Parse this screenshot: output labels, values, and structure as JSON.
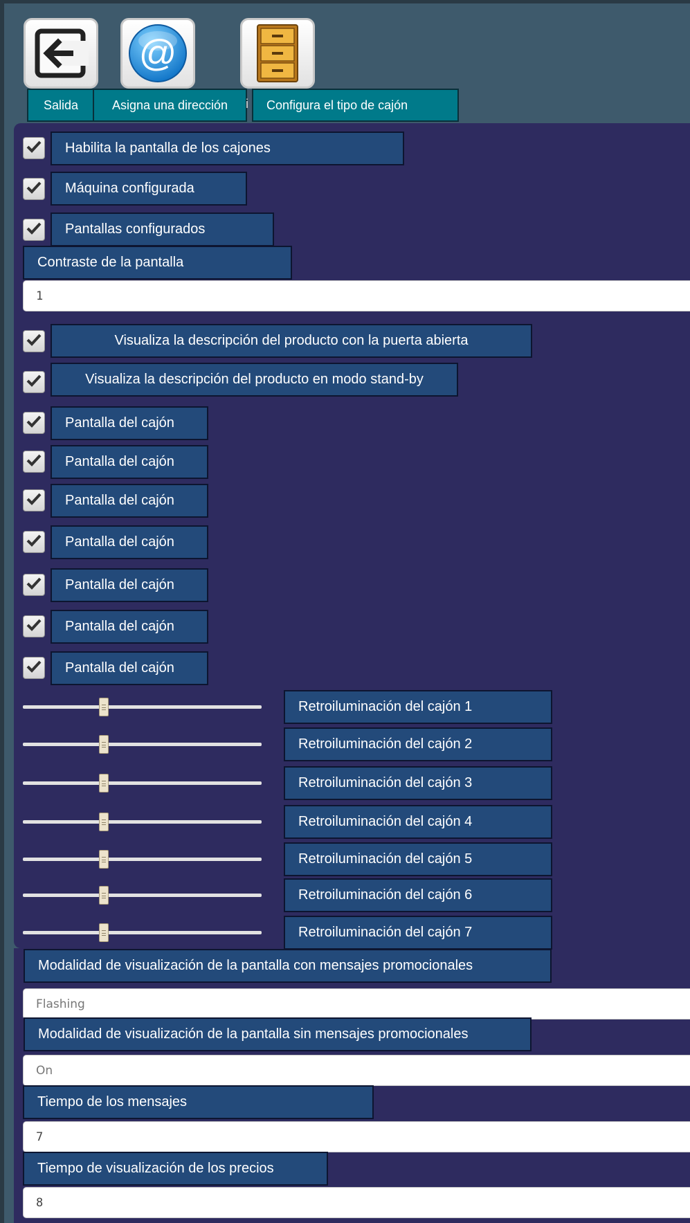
{
  "toolbar": {
    "exit_label": "Salida",
    "address_label": "Asigna una dirección",
    "address_icon_glyph": "@",
    "drawer_type_label": "Configura el tipo de cajón",
    "separator_glyph": "i"
  },
  "settings": {
    "enable_drawer_screen": "Habilita la pantalla de los cajones",
    "machine_configured": "Máquina configurada",
    "screens_configured": "Pantallas configurados",
    "screen_contrast_label": "Contraste de la pantalla",
    "screen_contrast_value": "1",
    "show_desc_door_open": "Visualiza la descripción del producto con la puerta abierta",
    "show_desc_standby": "Visualiza la descripción del producto en modo stand-by"
  },
  "drawer_screens": [
    {
      "label": "Pantalla del cajón",
      "checked": true
    },
    {
      "label": "Pantalla del cajón",
      "checked": true
    },
    {
      "label": "Pantalla del cajón",
      "checked": true
    },
    {
      "label": "Pantalla del cajón",
      "checked": true
    },
    {
      "label": "Pantalla del cajón",
      "checked": true
    },
    {
      "label": "Pantalla del cajón",
      "checked": true
    },
    {
      "label": "Pantalla del cajón",
      "checked": true
    }
  ],
  "backlights": [
    {
      "label": "Retroiluminación del cajón 1",
      "level_fraction": 0.34
    },
    {
      "label": "Retroiluminación del cajón 2",
      "level_fraction": 0.34
    },
    {
      "label": "Retroiluminación del cajón 3",
      "level_fraction": 0.34
    },
    {
      "label": "Retroiluminación del cajón 4",
      "level_fraction": 0.34
    },
    {
      "label": "Retroiluminación del cajón 5",
      "level_fraction": 0.34
    },
    {
      "label": "Retroiluminación del cajón 6",
      "level_fraction": 0.34
    },
    {
      "label": "Retroiluminación del cajón 7",
      "level_fraction": 0.34
    }
  ],
  "display": {
    "promo_mode_label": "Modalidad de visualización de la pantalla con mensajes promocionales",
    "promo_mode_value": "Flashing",
    "nopromo_mode_label": "Modalidad de visualización de la pantalla sin mensajes promocionales",
    "nopromo_mode_value": "On",
    "message_time_label": "Tiempo de los mensajes",
    "message_time_value": "7",
    "price_time_label": "Tiempo de visualización de los precios",
    "price_time_value": "8"
  },
  "colors": {
    "background": "#3e5a6c",
    "panel": "#2e2b5f",
    "label_bg": "#234a7a",
    "toolbar_label_bg": "#007a8a"
  }
}
